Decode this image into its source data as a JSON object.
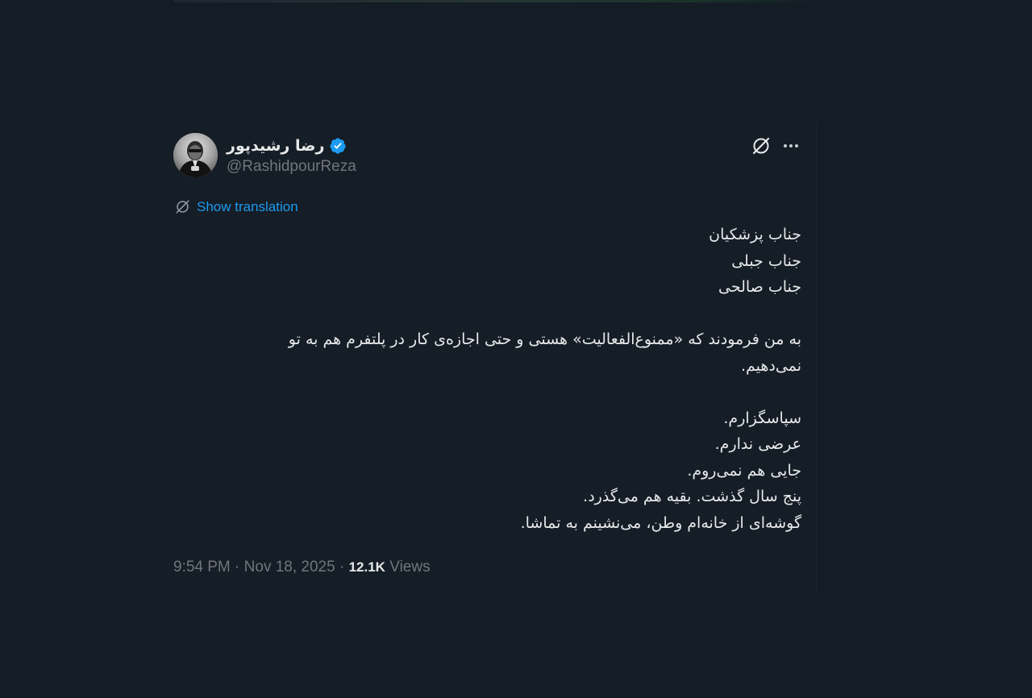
{
  "author": {
    "display_name": "رضا رشیدپور",
    "handle": "@RashidpourReza",
    "verified": true,
    "avatar_icon": "avatar-photo"
  },
  "actions": {
    "grok_icon": "grok-icon",
    "more_icon": "more-icon"
  },
  "translation": {
    "label": "Show translation",
    "icon": "translate-icon"
  },
  "tweet": {
    "lines": [
      "جناب پزشکیان",
      "جناب جبلی",
      "جناب صالحی",
      "",
      "به من فرمودند که «ممنوع‌الفعالیت» هستی و حتی اجازه‌ی کار در پلتفرم هم به تو",
      "نمی‌دهیم.",
      "",
      "سپاسگزارم.",
      "عرضی ندارم.",
      "جایی هم نمی‌روم.",
      "پنج سال گذشت. بقیه هم می‌گذرد.",
      "گوشه‌ای از خانه‌ام وطن، می‌نشینم به تماشا."
    ]
  },
  "meta": {
    "time": "9:54 PM",
    "separator": "·",
    "date": "Nov 18, 2025",
    "views_count": "12.1K",
    "views_label": "Views"
  },
  "colors": {
    "background": "#141d26",
    "text": "#e7e9ea",
    "secondary": "#71767b",
    "accent": "#1d9bf0"
  }
}
